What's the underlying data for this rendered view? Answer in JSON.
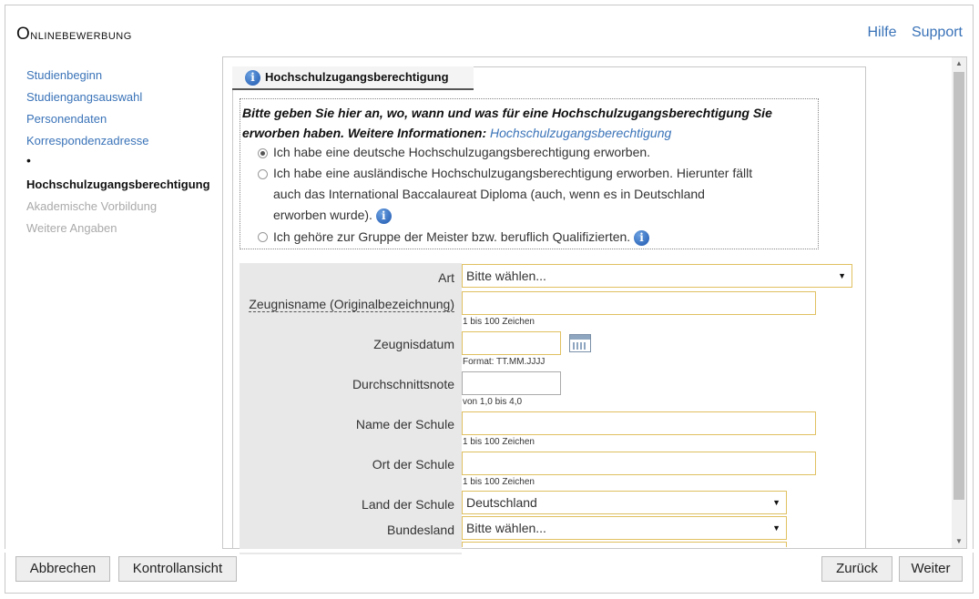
{
  "header": {
    "title_initial": "O",
    "title_rest": "nlinebewerbung",
    "links": [
      "Hilfe",
      "Support"
    ]
  },
  "nav": {
    "items": [
      {
        "label": "Studienbeginn",
        "state": "link"
      },
      {
        "label": "Studiengangsauswahl",
        "state": "link"
      },
      {
        "label": "Personendaten",
        "state": "link"
      },
      {
        "label": "Korrespondenzadresse",
        "state": "link"
      },
      {
        "label": "•",
        "state": "bullet"
      },
      {
        "label": "Hochschulzugangsberechtigung",
        "state": "current"
      },
      {
        "label": "Akademische Vorbildung",
        "state": "disabled"
      },
      {
        "label": "Weitere Angaben",
        "state": "disabled"
      }
    ]
  },
  "tab": {
    "label": "Hochschulzugangsberechtigung",
    "icon": "info-icon"
  },
  "question": {
    "text": "Bitte geben Sie hier an, wo, wann und was für eine Hochschulzugangsberechtigung Sie erworben haben. Weitere Informationen:",
    "link": "Hochschulzugangsberechtigung",
    "options": [
      {
        "line1": "Ich habe eine deutsche Hochschulzugangsberechtigung erworben.",
        "checked": true
      },
      {
        "line1": "Ich habe eine ausländische Hochschulzugangsberechtigung erworben. Hierunter fällt",
        "line2": "auch das International Baccalaureat Diploma (auch, wenn es in Deutschland",
        "line3": "erworben wurde).",
        "checked": false
      },
      {
        "line1": "Ich gehöre zur Gruppe der Meister bzw. beruflich Qualifizierten.",
        "checked": false
      }
    ]
  },
  "form": {
    "art": {
      "label": "Art",
      "value": "Bitte wählen..."
    },
    "zeugnisname": {
      "label": "Zeugnisname (Originalbezeichnung)",
      "value": "",
      "hint": "1 bis 100 Zeichen"
    },
    "zeugnisdatum": {
      "label": "Zeugnisdatum",
      "value": "",
      "hint": "Format: TT.MM.JJJJ"
    },
    "note": {
      "label": "Durchschnittsnote",
      "value": "",
      "hint": "von 1,0 bis 4,0"
    },
    "schulname": {
      "label": "Name der Schule",
      "value": "",
      "hint": "1 bis 100 Zeichen"
    },
    "schulort": {
      "label": "Ort der Schule",
      "value": "",
      "hint": "1 bis 100 Zeichen"
    },
    "land": {
      "label": "Land der Schule",
      "value": "Deutschland"
    },
    "bundesland": {
      "label": "Bundesland",
      "value": "Bitte wählen..."
    }
  },
  "buttons": {
    "cancel": "Abbrechen",
    "review": "Kontrollansicht",
    "back": "Zurück",
    "next": "Weiter"
  },
  "colors": {
    "link": "#3a73b8",
    "field_border": "#e0c060",
    "form_bg": "#e8e8e8"
  }
}
